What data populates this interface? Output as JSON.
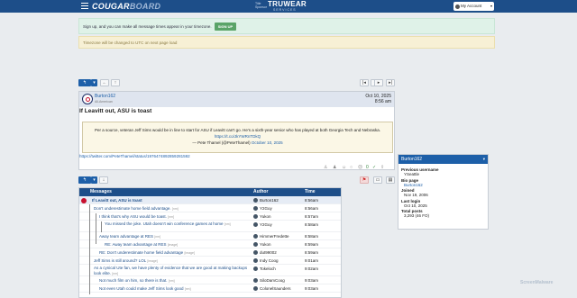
{
  "header": {
    "logo_a": "COUGAR",
    "logo_b": "BOARD",
    "sponsor_line1": "Title",
    "sponsor_line2": "Sponsor",
    "sponsor_brand": "TRUWEAR",
    "sponsor_tag": "SERVICES",
    "account_label": "My Account"
  },
  "banners": {
    "timezone_text": "Sign up, and you can make all message times appear in your timezone.",
    "signup_label": "SIGN UP",
    "utc_notice": "Timezone will be changed to UTC on next page load"
  },
  "post": {
    "author": "Burton162",
    "author_title": "All-American",
    "date": "Oct 10, 2025",
    "time": "8:56 am",
    "title": "If Leavitt out, ASU is toast",
    "quote_text": "Per a source, veteran Jeff Sims would be in line to start for ASU if Leavitt can't go. He's a sixth-year senior who has played at both Georgia Tech and Nebraska.",
    "quote_link": "https://t.co/JkYWRnTDkQ",
    "quote_sig": "— Pete Thamel (@PeteThamel)",
    "quote_date": "October 10, 2025",
    "tweet_url": "https://twitter.com/PeteThamel/status/1976474892859281592",
    "reply_count": "0"
  },
  "sidebar": {
    "header": "Burton162",
    "prev_username_label": "Previous username",
    "prev_username": "YSeattle",
    "bio_label": "Bio page",
    "bio_value": "Burton162",
    "joined_label": "Joined",
    "joined_value": "Nov 19, 2006",
    "last_login_label": "Last login",
    "last_login_value": "Oct 10, 2025",
    "total_posts_label": "Total posts",
    "total_posts_value": "3,293 (46 FO)"
  },
  "table": {
    "col_messages": "Messages",
    "col_author": "Author",
    "col_time": "Time",
    "rows": [
      {
        "subject": "If Leavitt out, ASU is toast",
        "size": "",
        "author": "Burton162",
        "time": "8:56am"
      },
      {
        "subject": "Don't underestimate home field advantage.",
        "size": "[nm]",
        "author": "Y2Guy",
        "time": "8:56am"
      },
      {
        "subject": "I think that's why ASU would be toast.",
        "size": "[nm]",
        "author": "Yukon",
        "time": "8:57am"
      },
      {
        "subject": "You missed the joke. Utah doesn't win conference games at home",
        "size": "[nm]",
        "author": "Y2Guy",
        "time": "8:58am"
      },
      {
        "subject": "Away team advantage at RES",
        "size": "[nm]",
        "author": "HimmerFredette",
        "time": "8:58am"
      },
      {
        "subject": "RE: Away team advantage at RES",
        "size": "[image]",
        "author": "Yukon",
        "time": "8:59am"
      },
      {
        "subject": "RE: Don't underestimate home field advantage",
        "size": "[image]",
        "author": "dut99002",
        "time": "8:59am"
      },
      {
        "subject": "Jeff Sims is still around? LOL",
        "size": "[image]",
        "author": "Indy Coog",
        "time": "9:01am"
      },
      {
        "subject": "As a cynical Ute fan, we have plenty of evidence that we are good at making backups look elite.",
        "size": "[nm]",
        "author": "Tokeloch",
        "time": "9:02am"
      },
      {
        "subject": "Not much film on him, so there is that.",
        "size": "[nm]",
        "author": "SiloDamCoog",
        "time": "9:03am"
      },
      {
        "subject": "Not even Utah could make Jeff Sims look good",
        "size": "[nm]",
        "author": "ColonelSaunders",
        "time": "9:03am"
      }
    ]
  },
  "watermark": "ScreenMalware"
}
